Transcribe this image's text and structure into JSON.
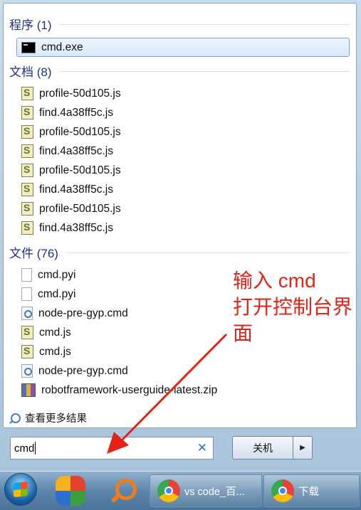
{
  "groups": [
    {
      "title": "程序 (1)",
      "items": [
        {
          "label": "cmd.exe",
          "icon": "cmd-icon",
          "selected": true
        }
      ]
    },
    {
      "title": "文档 (8)",
      "items": [
        {
          "label": "profile-50d105.js",
          "icon": "js-file-icon"
        },
        {
          "label": "find.4a38ff5c.js",
          "icon": "js-file-icon"
        },
        {
          "label": "profile-50d105.js",
          "icon": "js-file-icon"
        },
        {
          "label": "find.4a38ff5c.js",
          "icon": "js-file-icon"
        },
        {
          "label": "profile-50d105.js",
          "icon": "js-file-icon"
        },
        {
          "label": "find.4a38ff5c.js",
          "icon": "js-file-icon"
        },
        {
          "label": "profile-50d105.js",
          "icon": "js-file-icon"
        },
        {
          "label": "find.4a38ff5c.js",
          "icon": "js-file-icon"
        }
      ]
    },
    {
      "title": "文件 (76)",
      "items": [
        {
          "label": "cmd.pyi",
          "icon": "blank-file-icon"
        },
        {
          "label": "cmd.pyi",
          "icon": "blank-file-icon"
        },
        {
          "label": "node-pre-gyp.cmd",
          "icon": "cmd-script-icon"
        },
        {
          "label": "cmd.js",
          "icon": "js-file-icon"
        },
        {
          "label": "cmd.js",
          "icon": "js-file-icon"
        },
        {
          "label": "node-pre-gyp.cmd",
          "icon": "cmd-script-icon"
        },
        {
          "label": "robotframework-userguide-latest.zip",
          "icon": "zip-archive-icon"
        }
      ]
    }
  ],
  "see_more": "查看更多结果",
  "search": {
    "value": "cmd"
  },
  "shutdown_label": "关机",
  "annotation": {
    "line1": "输入 cmd",
    "line2": "打开控制台界",
    "line3": "面",
    "color": "#e42317"
  },
  "taskbar": {
    "items": [
      {
        "label": "vs code_百...",
        "icon": "chrome-icon"
      },
      {
        "label": "下载",
        "icon": "chrome-icon"
      }
    ]
  }
}
